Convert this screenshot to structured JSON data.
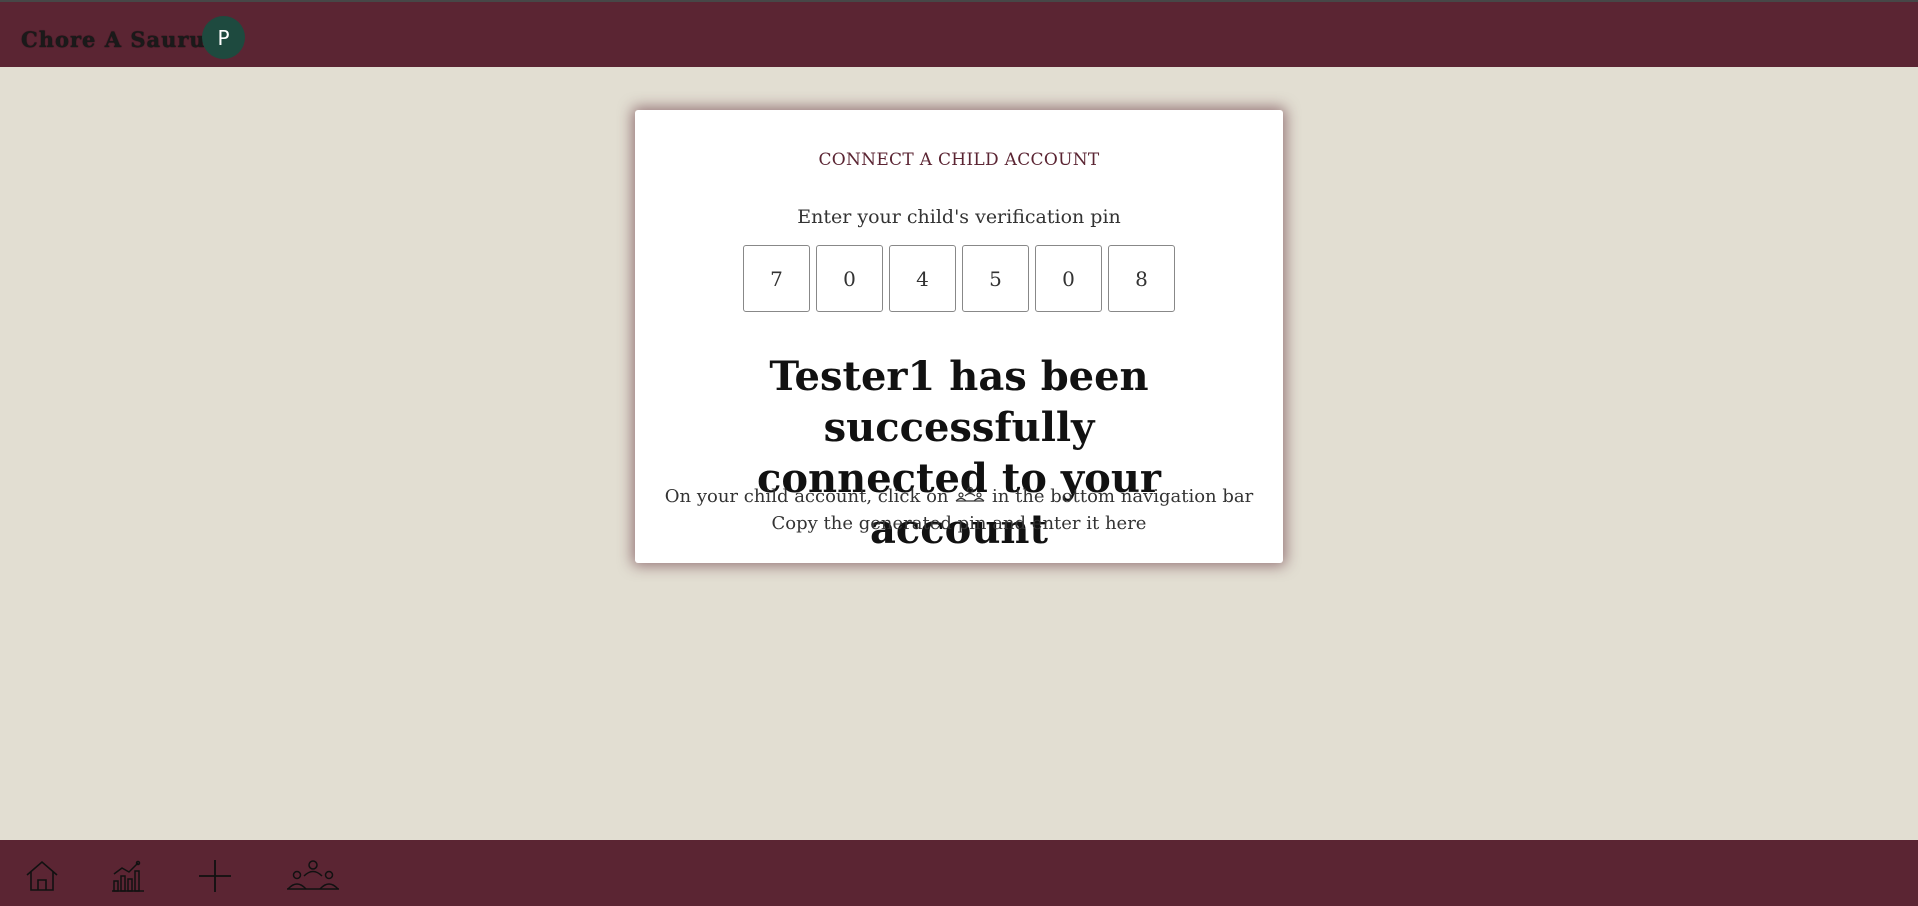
{
  "header": {
    "brand": "Chore A Saurus",
    "avatar_initial": "P"
  },
  "card": {
    "title": "CONNECT A CHILD ACCOUNT",
    "pin_prompt": "Enter your child's verification pin",
    "pin_digits": [
      "7",
      "0",
      "4",
      "5",
      "0",
      "8"
    ],
    "success_message": "Tester1 has been successfully connected to your account",
    "instructions": {
      "line1_before_icon": "On your child account, click on",
      "line1_icon": "connect-accounts-icon",
      "line1_after_icon": "in the bottom navigation bar",
      "line2": "Copy the generated pin and enter it here"
    }
  },
  "bottom_nav": {
    "items": [
      {
        "icon": "home-icon"
      },
      {
        "icon": "stats-chart-icon"
      },
      {
        "icon": "add-icon"
      },
      {
        "icon": "connect-accounts-icon"
      }
    ]
  },
  "colors": {
    "bar": "#5b2533",
    "background": "#e2ded2",
    "avatar": "#1e4a3f"
  }
}
